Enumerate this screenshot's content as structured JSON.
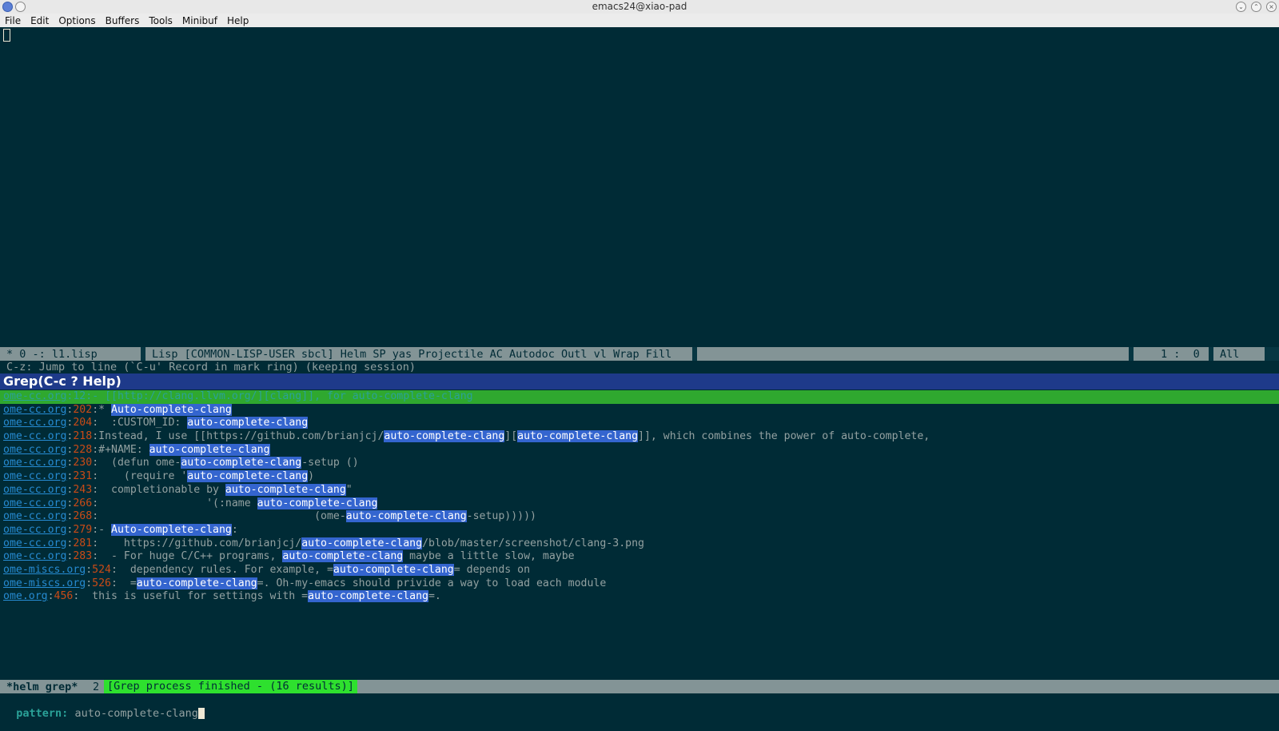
{
  "window": {
    "title": "emacs24@xiao-pad"
  },
  "menu": [
    "File",
    "Edit",
    "Options",
    "Buffers",
    "Tools",
    "Minibuf",
    "Help"
  ],
  "modeline": {
    "left": "* 0 -: l1.lisp",
    "modes": "Lisp [COMMON-LISP-USER sbcl] Helm SP yas Projectile AC Autodoc Outl vl Wrap Fill",
    "position": "1 :  0",
    "scroll": "All"
  },
  "echo": "C-z: Jump to line (`C-u' Record in mark ring) (keeping session)",
  "helm": {
    "header": "Grep(C-c ? Help)",
    "results": [
      {
        "file": "ome-cc.org",
        "line": "12",
        "parts": [
          [
            "t",
            ":- [["
          ],
          [
            "t",
            "http://clang.llvm.org/"
          ],
          [
            "t",
            "]["
          ],
          [
            "t",
            "clang"
          ],
          [
            "t",
            "]], for auto-complete-clang"
          ]
        ],
        "selected": true
      },
      {
        "file": "ome-cc.org",
        "line": "202",
        "parts": [
          [
            "t",
            ":* "
          ],
          [
            "h",
            "Auto-complete-clang"
          ]
        ]
      },
      {
        "file": "ome-cc.org",
        "line": "204",
        "parts": [
          [
            "t",
            ":  :CUSTOM_ID: "
          ],
          [
            "h",
            "auto-complete-clang"
          ]
        ]
      },
      {
        "file": "ome-cc.org",
        "line": "218",
        "parts": [
          [
            "t",
            ":Instead, I use [[https://github.com/brianjcj/"
          ],
          [
            "h",
            "auto-complete-clang"
          ],
          [
            "t",
            "]["
          ],
          [
            "h",
            "auto-complete-clang"
          ],
          [
            "t",
            "]], which combines the power of auto-complete,"
          ]
        ]
      },
      {
        "file": "ome-cc.org",
        "line": "228",
        "parts": [
          [
            "t",
            ":#+NAME: "
          ],
          [
            "h",
            "auto-complete-clang"
          ]
        ]
      },
      {
        "file": "ome-cc.org",
        "line": "230",
        "parts": [
          [
            "t",
            ":  (defun ome-"
          ],
          [
            "h",
            "auto-complete-clang"
          ],
          [
            "t",
            "-setup ()"
          ]
        ]
      },
      {
        "file": "ome-cc.org",
        "line": "231",
        "parts": [
          [
            "t",
            ":    (require '"
          ],
          [
            "h",
            "auto-complete-clang"
          ],
          [
            "t",
            ")"
          ]
        ]
      },
      {
        "file": "ome-cc.org",
        "line": "243",
        "parts": [
          [
            "t",
            ":  completionable by "
          ],
          [
            "h",
            "auto-complete-clang"
          ],
          [
            "t",
            "\""
          ]
        ]
      },
      {
        "file": "ome-cc.org",
        "line": "266",
        "parts": [
          [
            "t",
            ":                 '(:name "
          ],
          [
            "h",
            "auto-complete-clang"
          ]
        ]
      },
      {
        "file": "ome-cc.org",
        "line": "268",
        "parts": [
          [
            "t",
            ":                                  (ome-"
          ],
          [
            "h",
            "auto-complete-clang"
          ],
          [
            "t",
            "-setup)))))"
          ]
        ]
      },
      {
        "file": "ome-cc.org",
        "line": "279",
        "parts": [
          [
            "t",
            ":- "
          ],
          [
            "h",
            "Auto-complete-clang"
          ],
          [
            "t",
            ":"
          ]
        ]
      },
      {
        "file": "ome-cc.org",
        "line": "281",
        "parts": [
          [
            "t",
            ":    https://github.com/brianjcj/"
          ],
          [
            "h",
            "auto-complete-clang"
          ],
          [
            "t",
            "/blob/master/screenshot/clang-3.png"
          ]
        ]
      },
      {
        "file": "ome-cc.org",
        "line": "283",
        "parts": [
          [
            "t",
            ":  - For huge C/C++ programs, "
          ],
          [
            "h",
            "auto-complete-clang"
          ],
          [
            "t",
            " maybe a little slow, maybe"
          ]
        ]
      },
      {
        "file": "ome-miscs.org",
        "line": "524",
        "parts": [
          [
            "t",
            ":  dependency rules. For example, ="
          ],
          [
            "h",
            "auto-complete-clang"
          ],
          [
            "t",
            "= depends on"
          ]
        ]
      },
      {
        "file": "ome-miscs.org",
        "line": "526",
        "parts": [
          [
            "t",
            ":  ="
          ],
          [
            "h",
            "auto-complete-clang"
          ],
          [
            "t",
            "=. Oh-my-emacs should privide a way to load each module"
          ]
        ]
      },
      {
        "file": "ome.org",
        "line": "456",
        "parts": [
          [
            "t",
            ":  this is useful for settings with ="
          ],
          [
            "h",
            "auto-complete-clang"
          ],
          [
            "t",
            "=."
          ]
        ]
      }
    ]
  },
  "bottom_modeline": {
    "buffer": "*helm grep*",
    "count": "2",
    "status": "[Grep process finished - (16 results)]"
  },
  "minibuffer": {
    "label": "pattern:",
    "value": "auto-complete-clang"
  },
  "colors": {
    "background": "#002b36",
    "highlight": "#3465cf",
    "selected_row": "#2fa82f",
    "header": "#1e3a8a"
  }
}
